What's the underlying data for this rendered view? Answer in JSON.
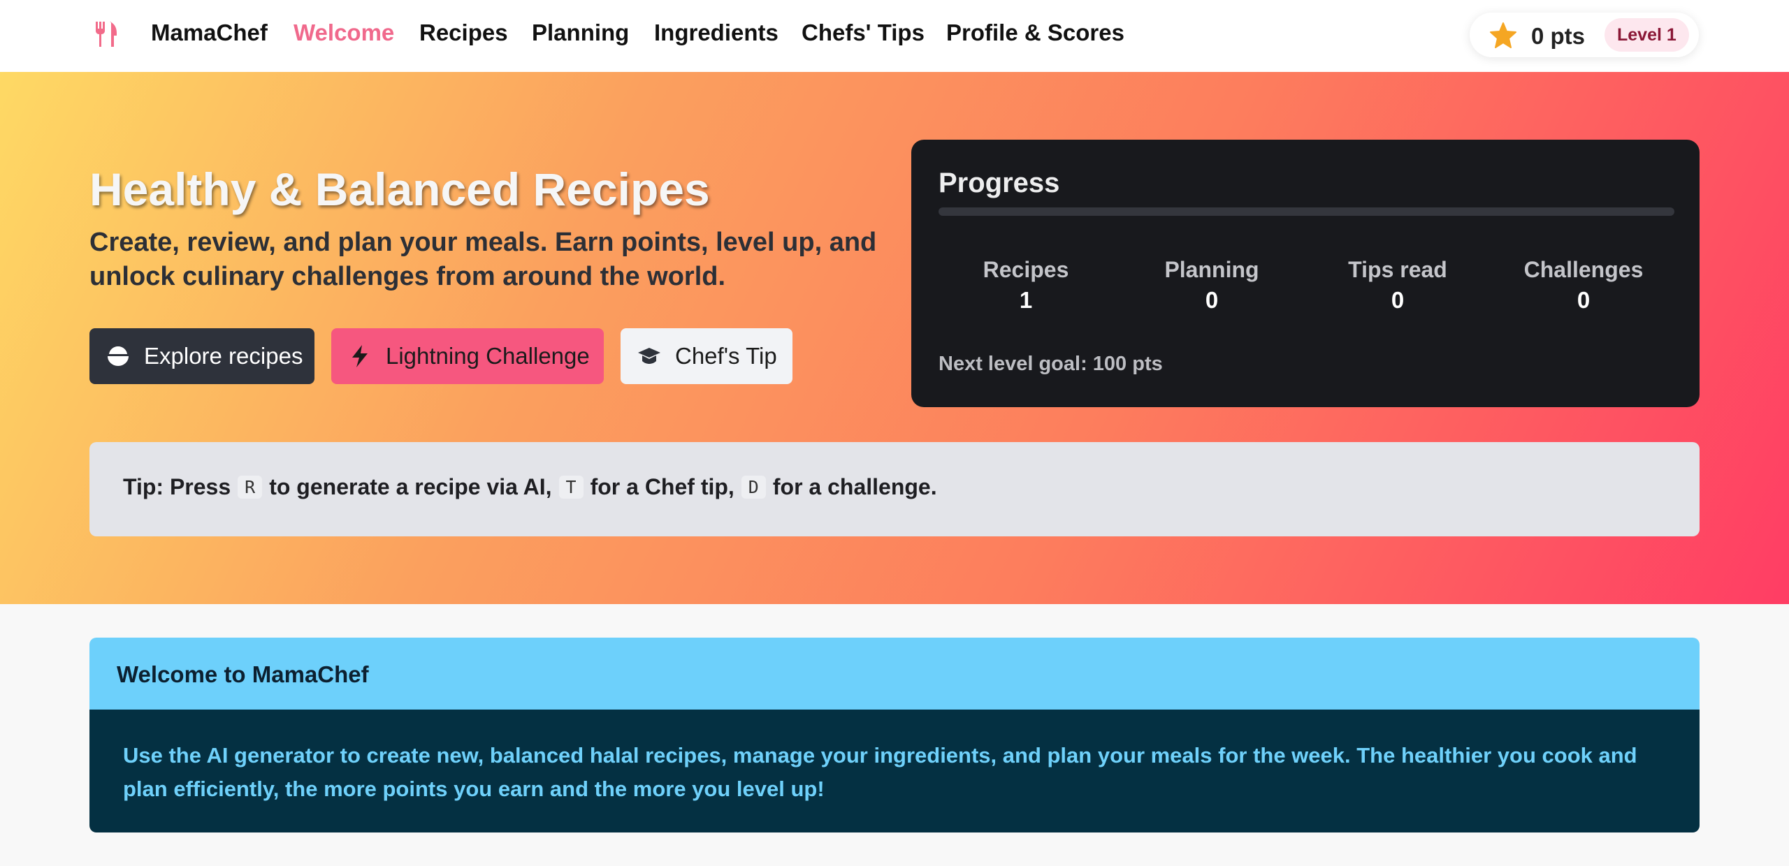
{
  "nav": {
    "logo_icon": "utensils-icon",
    "brand": "MamaChef",
    "links": [
      "Welcome",
      "Recipes",
      "Planning",
      "Ingredients",
      "Chefs' Tips",
      "Profile & Scores"
    ],
    "active": "Welcome",
    "score": {
      "icon": "star-icon",
      "points": "0 pts",
      "level": "Level 1"
    }
  },
  "hero": {
    "title": "Healthy & Balanced Recipes",
    "subtitle": "Create, review, and plan your meals. Earn points, level up, and unlock culinary challenges from around the world.",
    "buttons": {
      "explore": {
        "label": "Explore recipes",
        "icon": "bowl-icon"
      },
      "challenge": {
        "label": "Lightning Challenge",
        "icon": "bolt-icon"
      },
      "tip": {
        "label": "Chef's Tip",
        "icon": "graduation-cap-icon"
      }
    }
  },
  "progress": {
    "title": "Progress",
    "fraction": 0,
    "stats": [
      {
        "label": "Recipes",
        "value": "1"
      },
      {
        "label": "Planning",
        "value": "0"
      },
      {
        "label": "Tips read",
        "value": "0"
      },
      {
        "label": "Challenges",
        "value": "0"
      }
    ],
    "goal": "Next level goal: 100 pts"
  },
  "tip": {
    "prefix": "Tip: Press",
    "key1": "R",
    "mid1": "to generate a recipe via AI,",
    "key2": "T",
    "mid2": "for a Chef tip,",
    "key3": "D",
    "suffix": "for a challenge."
  },
  "welcome": {
    "title": "Welcome to MamaChef",
    "body": "Use the AI generator to create new, balanced halal recipes, manage your ingredients, and plan your meals for the week. The healthier you cook and plan efficiently, the more points you earn and the more you level up!"
  },
  "colors": {
    "accent": "#f0698c",
    "pink_button": "#f6577f",
    "dark": "#18191d",
    "info": "#6dd0fb"
  }
}
